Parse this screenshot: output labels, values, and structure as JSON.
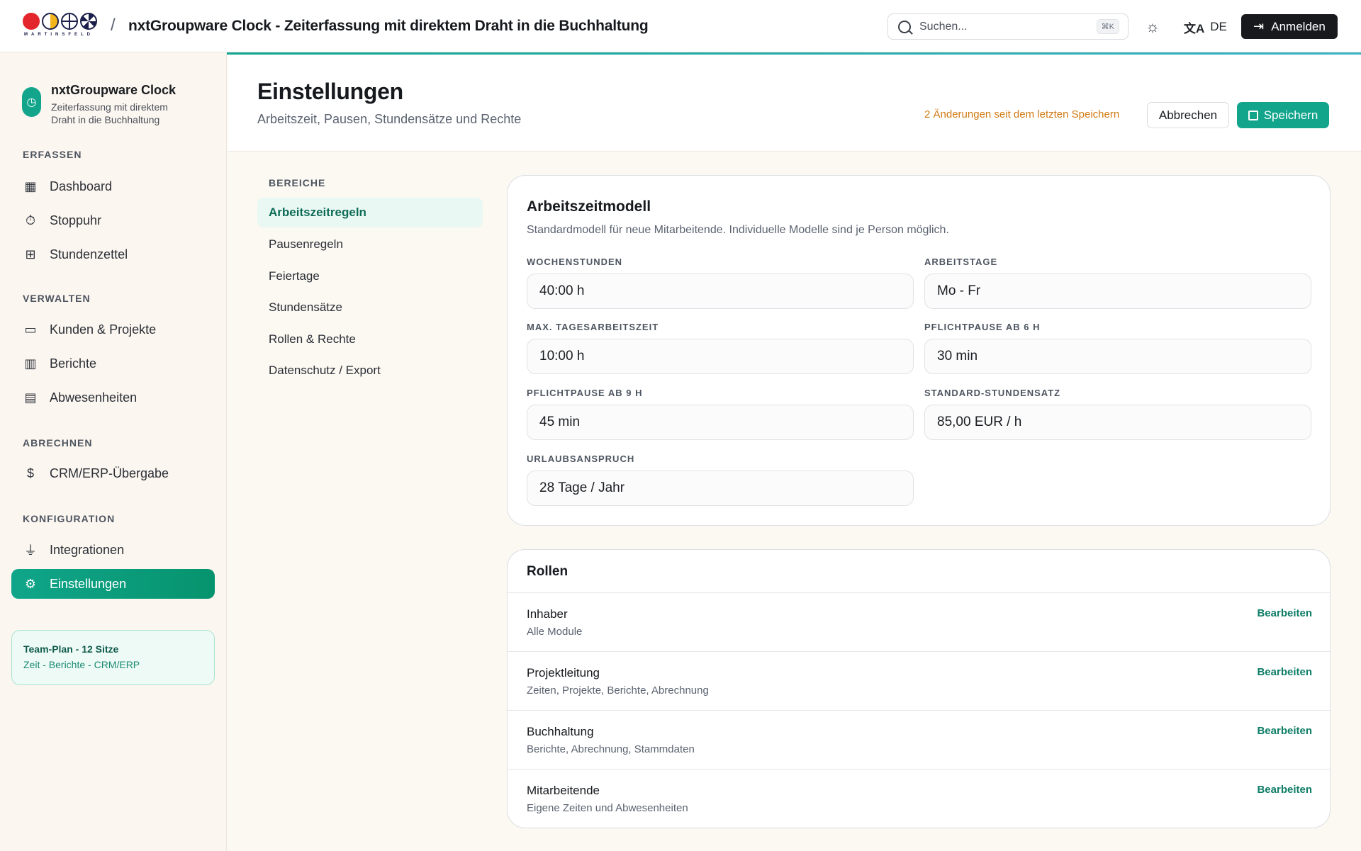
{
  "topbar": {
    "brand_word": "MARTINSFELD",
    "separator": "/",
    "title": "nxtGroupware Clock - Zeiterfassung mit direktem Draht in die Buchhaltung",
    "search_placeholder": "Suchen...",
    "search_shortcut": "⌘K",
    "language": "DE",
    "login_label": "Anmelden"
  },
  "sidebar": {
    "brand_name": "nxtGroupware Clock",
    "brand_sub": "Zeiterfassung mit direktem Draht in die Buchhaltung",
    "sections": [
      {
        "label": "ERFASSEN",
        "items": [
          {
            "label": "Dashboard",
            "icon": "dashboard-icon"
          },
          {
            "label": "Stoppuhr",
            "icon": "stopwatch-icon"
          },
          {
            "label": "Stundenzettel",
            "icon": "table-icon"
          }
        ]
      },
      {
        "label": "VERWALTEN",
        "items": [
          {
            "label": "Kunden & Projekte",
            "icon": "folder-icon"
          },
          {
            "label": "Berichte",
            "icon": "bar-chart-icon"
          },
          {
            "label": "Abwesenheiten",
            "icon": "calendar-icon"
          }
        ]
      },
      {
        "label": "ABRECHNEN",
        "items": [
          {
            "label": "CRM/ERP-Übergabe",
            "icon": "invoice-icon"
          }
        ]
      },
      {
        "label": "KONFIGURATION",
        "items": [
          {
            "label": "Integrationen",
            "icon": "plug-icon"
          },
          {
            "label": "Einstellungen",
            "icon": "gear-icon"
          }
        ]
      }
    ],
    "plan_title": "Team-Plan - 12 Sitze",
    "plan_sub": "Zeit - Berichte - CRM/ERP"
  },
  "header": {
    "title": "Einstellungen",
    "subtitle": "Arbeitszeit, Pausen, Stundensätze und Rechte",
    "changes_note": "2 Änderungen seit dem letzten Speichern",
    "cancel_label": "Abbrechen",
    "save_label": "Speichern"
  },
  "subnav": {
    "label": "BEREICHE",
    "items": [
      "Arbeitszeitregeln",
      "Pausenregeln",
      "Feiertage",
      "Stundensätze",
      "Rollen & Rechte",
      "Datenschutz / Export"
    ]
  },
  "model": {
    "title": "Arbeitszeitmodell",
    "subtitle": "Standardmodell für neue Mitarbeitende. Individuelle Modelle sind je Person möglich.",
    "fields": [
      {
        "label": "WOCHENSTUNDEN",
        "value": "40:00 h"
      },
      {
        "label": "ARBEITSTAGE",
        "value": "Mo - Fr"
      },
      {
        "label": "MAX. TAGESARBEITSZEIT",
        "value": "10:00 h"
      },
      {
        "label": "PFLICHTPAUSE AB 6 H",
        "value": "30 min"
      },
      {
        "label": "PFLICHTPAUSE AB 9 H",
        "value": "45 min"
      },
      {
        "label": "STANDARD-STUNDENSATZ",
        "value": "85,00 EUR / h"
      },
      {
        "label": "URLAUBSANSPRUCH",
        "value": "28 Tage / Jahr"
      }
    ]
  },
  "roles": {
    "title": "Rollen",
    "edit_label": "Bearbeiten",
    "items": [
      {
        "name": "Inhaber",
        "desc": "Alle Module"
      },
      {
        "name": "Projektleitung",
        "desc": "Zeiten, Projekte, Berichte, Abrechnung"
      },
      {
        "name": "Buchhaltung",
        "desc": "Berichte, Abrechnung, Stammdaten"
      },
      {
        "name": "Mitarbeitende",
        "desc": "Eigene Zeiten und Abwesenheiten"
      }
    ]
  },
  "colors": {
    "accent": "#12a58c",
    "warning": "#d17a12",
    "dark": "#17191c"
  }
}
